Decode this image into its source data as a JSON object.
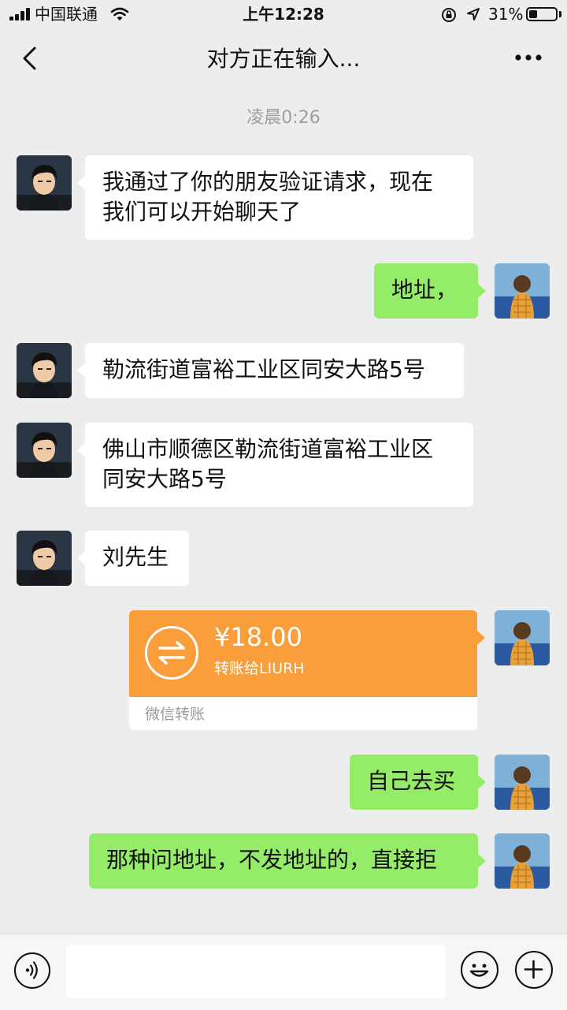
{
  "status_bar": {
    "carrier": "中国联通",
    "time": "上午12:28",
    "battery_percent": "31%",
    "battery_level": 0.31
  },
  "nav": {
    "title": "对方正在输入...",
    "back_icon": "chevron-left-icon",
    "more_icon": "more-dots-icon"
  },
  "chat": {
    "timestamp": "凌晨0:26",
    "messages": [
      {
        "side": "left",
        "line1": "我通过了你的朋友验证请求，现在",
        "line2": "我们可以开始聊天了"
      },
      {
        "side": "right",
        "text": "地址，"
      },
      {
        "side": "left",
        "text": "勒流街道富裕工业区同安大路5号"
      },
      {
        "side": "left",
        "line1": "佛山市顺德区勒流街道富裕工业区",
        "line2": "同安大路5号"
      },
      {
        "side": "left",
        "text": "刘先生"
      },
      {
        "side": "right",
        "type": "transfer",
        "amount": "¥18.00",
        "to": "转账给LIURH",
        "footer": "微信转账"
      },
      {
        "side": "right",
        "text": "自己去买"
      },
      {
        "side": "right",
        "text": "那种问地址，不发地址的，直接拒"
      }
    ]
  },
  "input_bar": {
    "voice_icon": "voice-icon",
    "emoji_icon": "emoji-icon",
    "plus_icon": "plus-icon",
    "placeholder": ""
  },
  "colors": {
    "background": "#ededed",
    "bubble_green": "#95ec69",
    "bubble_white": "#ffffff",
    "transfer_orange": "#fa9d3b"
  }
}
